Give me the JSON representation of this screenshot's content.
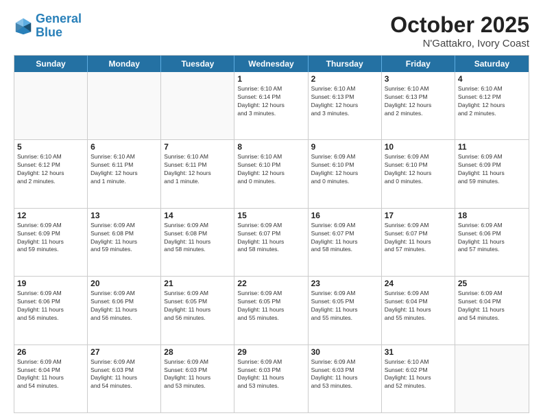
{
  "header": {
    "logo_line1": "General",
    "logo_line2": "Blue",
    "month": "October 2025",
    "location": "N'Gattakro, Ivory Coast"
  },
  "weekdays": [
    "Sunday",
    "Monday",
    "Tuesday",
    "Wednesday",
    "Thursday",
    "Friday",
    "Saturday"
  ],
  "weeks": [
    [
      {
        "day": "",
        "info": ""
      },
      {
        "day": "",
        "info": ""
      },
      {
        "day": "",
        "info": ""
      },
      {
        "day": "1",
        "info": "Sunrise: 6:10 AM\nSunset: 6:14 PM\nDaylight: 12 hours\nand 3 minutes."
      },
      {
        "day": "2",
        "info": "Sunrise: 6:10 AM\nSunset: 6:13 PM\nDaylight: 12 hours\nand 3 minutes."
      },
      {
        "day": "3",
        "info": "Sunrise: 6:10 AM\nSunset: 6:13 PM\nDaylight: 12 hours\nand 2 minutes."
      },
      {
        "day": "4",
        "info": "Sunrise: 6:10 AM\nSunset: 6:12 PM\nDaylight: 12 hours\nand 2 minutes."
      }
    ],
    [
      {
        "day": "5",
        "info": "Sunrise: 6:10 AM\nSunset: 6:12 PM\nDaylight: 12 hours\nand 2 minutes."
      },
      {
        "day": "6",
        "info": "Sunrise: 6:10 AM\nSunset: 6:11 PM\nDaylight: 12 hours\nand 1 minute."
      },
      {
        "day": "7",
        "info": "Sunrise: 6:10 AM\nSunset: 6:11 PM\nDaylight: 12 hours\nand 1 minute."
      },
      {
        "day": "8",
        "info": "Sunrise: 6:10 AM\nSunset: 6:10 PM\nDaylight: 12 hours\nand 0 minutes."
      },
      {
        "day": "9",
        "info": "Sunrise: 6:09 AM\nSunset: 6:10 PM\nDaylight: 12 hours\nand 0 minutes."
      },
      {
        "day": "10",
        "info": "Sunrise: 6:09 AM\nSunset: 6:10 PM\nDaylight: 12 hours\nand 0 minutes."
      },
      {
        "day": "11",
        "info": "Sunrise: 6:09 AM\nSunset: 6:09 PM\nDaylight: 11 hours\nand 59 minutes."
      }
    ],
    [
      {
        "day": "12",
        "info": "Sunrise: 6:09 AM\nSunset: 6:09 PM\nDaylight: 11 hours\nand 59 minutes."
      },
      {
        "day": "13",
        "info": "Sunrise: 6:09 AM\nSunset: 6:08 PM\nDaylight: 11 hours\nand 59 minutes."
      },
      {
        "day": "14",
        "info": "Sunrise: 6:09 AM\nSunset: 6:08 PM\nDaylight: 11 hours\nand 58 minutes."
      },
      {
        "day": "15",
        "info": "Sunrise: 6:09 AM\nSunset: 6:07 PM\nDaylight: 11 hours\nand 58 minutes."
      },
      {
        "day": "16",
        "info": "Sunrise: 6:09 AM\nSunset: 6:07 PM\nDaylight: 11 hours\nand 58 minutes."
      },
      {
        "day": "17",
        "info": "Sunrise: 6:09 AM\nSunset: 6:07 PM\nDaylight: 11 hours\nand 57 minutes."
      },
      {
        "day": "18",
        "info": "Sunrise: 6:09 AM\nSunset: 6:06 PM\nDaylight: 11 hours\nand 57 minutes."
      }
    ],
    [
      {
        "day": "19",
        "info": "Sunrise: 6:09 AM\nSunset: 6:06 PM\nDaylight: 11 hours\nand 56 minutes."
      },
      {
        "day": "20",
        "info": "Sunrise: 6:09 AM\nSunset: 6:06 PM\nDaylight: 11 hours\nand 56 minutes."
      },
      {
        "day": "21",
        "info": "Sunrise: 6:09 AM\nSunset: 6:05 PM\nDaylight: 11 hours\nand 56 minutes."
      },
      {
        "day": "22",
        "info": "Sunrise: 6:09 AM\nSunset: 6:05 PM\nDaylight: 11 hours\nand 55 minutes."
      },
      {
        "day": "23",
        "info": "Sunrise: 6:09 AM\nSunset: 6:05 PM\nDaylight: 11 hours\nand 55 minutes."
      },
      {
        "day": "24",
        "info": "Sunrise: 6:09 AM\nSunset: 6:04 PM\nDaylight: 11 hours\nand 55 minutes."
      },
      {
        "day": "25",
        "info": "Sunrise: 6:09 AM\nSunset: 6:04 PM\nDaylight: 11 hours\nand 54 minutes."
      }
    ],
    [
      {
        "day": "26",
        "info": "Sunrise: 6:09 AM\nSunset: 6:04 PM\nDaylight: 11 hours\nand 54 minutes."
      },
      {
        "day": "27",
        "info": "Sunrise: 6:09 AM\nSunset: 6:03 PM\nDaylight: 11 hours\nand 54 minutes."
      },
      {
        "day": "28",
        "info": "Sunrise: 6:09 AM\nSunset: 6:03 PM\nDaylight: 11 hours\nand 53 minutes."
      },
      {
        "day": "29",
        "info": "Sunrise: 6:09 AM\nSunset: 6:03 PM\nDaylight: 11 hours\nand 53 minutes."
      },
      {
        "day": "30",
        "info": "Sunrise: 6:09 AM\nSunset: 6:03 PM\nDaylight: 11 hours\nand 53 minutes."
      },
      {
        "day": "31",
        "info": "Sunrise: 6:10 AM\nSunset: 6:02 PM\nDaylight: 11 hours\nand 52 minutes."
      },
      {
        "day": "",
        "info": ""
      }
    ]
  ]
}
